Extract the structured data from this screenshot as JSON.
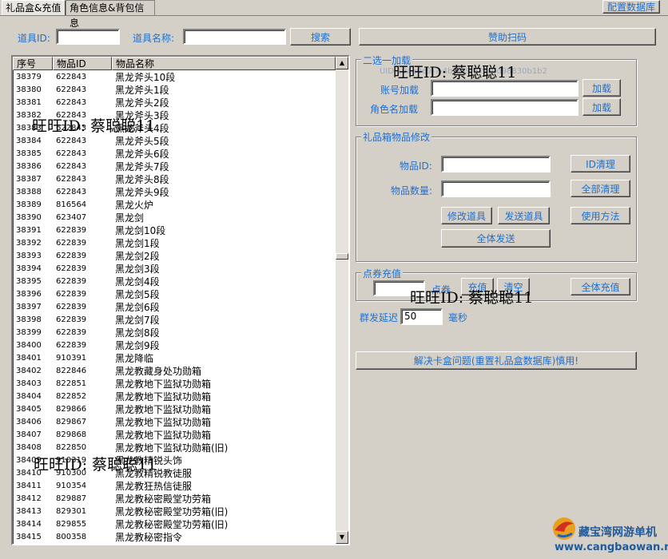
{
  "tabs": [
    {
      "label": "礼品盒&充值",
      "active": true
    },
    {
      "label": "角色信息&背包信息",
      "active": false
    }
  ],
  "config_button": "配置数据库",
  "search": {
    "id_label": "道具ID:",
    "name_label": "道具名称:",
    "id_value": "",
    "name_value": "",
    "button": "搜索"
  },
  "sponsor_button": "赞助扫码",
  "table": {
    "columns": [
      "序号",
      "物品ID",
      "物品名称"
    ],
    "rows": [
      [
        "38379",
        "622843",
        "黑龙斧头10段"
      ],
      [
        "38380",
        "622843",
        "黑龙斧头1段"
      ],
      [
        "38381",
        "622843",
        "黑龙斧头2段"
      ],
      [
        "38382",
        "622843",
        "黑龙斧头3段"
      ],
      [
        "38383",
        "622843",
        "黑龙斧头4段"
      ],
      [
        "38384",
        "622843",
        "黑龙斧头5段"
      ],
      [
        "38385",
        "622843",
        "黑龙斧头6段"
      ],
      [
        "38386",
        "622843",
        "黑龙斧头7段"
      ],
      [
        "38387",
        "622843",
        "黑龙斧头8段"
      ],
      [
        "38388",
        "622843",
        "黑龙斧头9段"
      ],
      [
        "38389",
        "816564",
        "黑龙火炉"
      ],
      [
        "38390",
        "623407",
        "黑龙剑"
      ],
      [
        "38391",
        "622839",
        "黑龙剑10段"
      ],
      [
        "38392",
        "622839",
        "黑龙剑1段"
      ],
      [
        "38393",
        "622839",
        "黑龙剑2段"
      ],
      [
        "38394",
        "622839",
        "黑龙剑3段"
      ],
      [
        "38395",
        "622839",
        "黑龙剑4段"
      ],
      [
        "38396",
        "622839",
        "黑龙剑5段"
      ],
      [
        "38397",
        "622839",
        "黑龙剑6段"
      ],
      [
        "38398",
        "622839",
        "黑龙剑7段"
      ],
      [
        "38399",
        "622839",
        "黑龙剑8段"
      ],
      [
        "38400",
        "622839",
        "黑龙剑9段"
      ],
      [
        "38401",
        "910391",
        "黑龙降临"
      ],
      [
        "38402",
        "822846",
        "黑龙教藏身处功勋箱"
      ],
      [
        "38403",
        "822851",
        "黑龙教地下监狱功勋箱"
      ],
      [
        "38404",
        "822852",
        "黑龙教地下监狱功勋箱"
      ],
      [
        "38405",
        "829866",
        "黑龙教地下监狱功勋箱"
      ],
      [
        "38406",
        "829867",
        "黑龙教地下监狱功勋箱"
      ],
      [
        "38407",
        "829868",
        "黑龙教地下监狱功勋箱"
      ],
      [
        "38408",
        "822850",
        "黑龙教地下监狱功勋箱(旧)"
      ],
      [
        "38409",
        "910319",
        "黑龙教精锐头饰"
      ],
      [
        "38410",
        "910300",
        "黑龙教精锐教徒服"
      ],
      [
        "38411",
        "910354",
        "黑龙教狂热信徒服"
      ],
      [
        "38412",
        "829887",
        "黑龙教秘密殿堂功劳箱"
      ],
      [
        "38413",
        "829301",
        "黑龙教秘密殿堂功劳箱(旧)"
      ],
      [
        "38414",
        "829855",
        "黑龙教秘密殿堂功劳箱(旧)"
      ],
      [
        "38415",
        "800358",
        "黑龙教秘密指令"
      ]
    ]
  },
  "group1": {
    "title": "二选一加载",
    "uid_text": "UID:19ae0e9-7-4b2-a9f5-5a0d98830b1b2",
    "account_label": "账号加载",
    "role_label": "角色名加载",
    "load_button": "加载",
    "account_value": "",
    "role_value": ""
  },
  "group2": {
    "title": "礼品箱物品修改",
    "item_id_label": "物品ID:",
    "item_count_label": "物品数量:",
    "id_clear": "ID清理",
    "clear_all": "全部清理",
    "modify": "修改道具",
    "send": "发送道具",
    "usage": "使用方法",
    "send_all": "全体发送",
    "item_id_value": "",
    "item_count_value": ""
  },
  "group3": {
    "title": "点券充值",
    "unit": "点券",
    "recharge": "充值",
    "clear": "清空",
    "recharge_all": "全体充值",
    "amount_value": ""
  },
  "delay": {
    "label": "群发延迟",
    "value": "50",
    "unit": "毫秒"
  },
  "fix_button": "解决卡盒问题(重置礼品盒数据库)慎用!",
  "watermarks": [
    "旺旺ID: 蔡聪聪11",
    "旺旺ID: 蔡聪聪11",
    "旺旺ID: 蔡聪聪11",
    "旺旺ID: 蔡聪聪11"
  ],
  "site_logo": {
    "name": "藏宝湾网游单机",
    "url": "www.cangbaowan.net"
  },
  "colors": {
    "label_blue": "#1f6fcf",
    "window_bg": "#d4d0c8"
  }
}
